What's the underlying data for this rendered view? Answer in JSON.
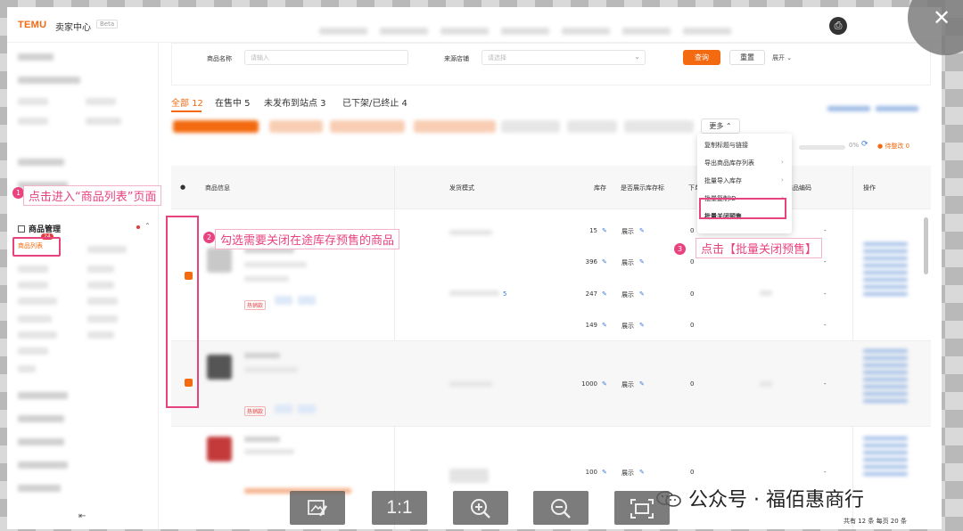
{
  "header": {
    "logo": "TEMU",
    "title": "卖家中心",
    "beta": "Beta"
  },
  "sidebar": {
    "section_title": "商品管理",
    "active_item": "商品列表",
    "active_badge": "24"
  },
  "filters": {
    "product_name_label": "商品名称",
    "product_name_placeholder": "请输入",
    "source_label": "来源店铺",
    "source_placeholder": "请选择",
    "query_button": "查询",
    "reset_button": "重置",
    "expand_button": "展开"
  },
  "tabs": [
    {
      "label": "全部 12",
      "active": true
    },
    {
      "label": "在售中 5",
      "active": false
    },
    {
      "label": "未发布到站点 3",
      "active": false
    },
    {
      "label": "已下架/已终止 4",
      "active": false
    }
  ],
  "toolbar": {
    "more_button": "更多",
    "progress_percent": "0%",
    "warning_badge": "待整改 0"
  },
  "more_menu": {
    "items": [
      {
        "label": "复制标题与链接",
        "has_submenu": false
      },
      {
        "label": "导出商品库存列表",
        "has_submenu": true
      },
      {
        "label": "批量导入库存",
        "has_submenu": true
      },
      {
        "label": "批量复制ID",
        "has_submenu": true
      },
      {
        "label": "批量关闭预售",
        "has_submenu": false
      }
    ]
  },
  "table": {
    "headers": {
      "product_info": "商品信息",
      "shipping_mode": "发货模式",
      "stock": "库存",
      "show_stock": "是否展示库存标",
      "order": "下单",
      "product_code": "商品编码",
      "actions": "操作"
    },
    "rows": [
      {
        "stock": "15",
        "show": "展示",
        "order": "0",
        "code": "-"
      },
      {
        "stock": "396",
        "show": "展示",
        "order": "0",
        "code": "-"
      },
      {
        "stock": "247",
        "show": "展示",
        "order": "0",
        "code": "-"
      },
      {
        "stock": "149",
        "show": "展示",
        "order": "0",
        "code": "-"
      },
      {
        "stock": "1000",
        "show": "展示",
        "order": "0",
        "code": "-"
      },
      {
        "stock": "100",
        "show": "展示",
        "order": "0",
        "code": "-"
      }
    ],
    "tag_hot": "热销款",
    "row_link_count": "5",
    "pagination": "共有 12 条 每页 20 条"
  },
  "annotations": [
    {
      "num": "1",
      "text": "点击进入“商品列表”页面"
    },
    {
      "num": "2",
      "text": "勾选需要关闭在途库存预售的商品"
    },
    {
      "num": "3",
      "text": "点击【批量关闭预售】"
    }
  ],
  "viewer_controls": {
    "actual_size": "1:1"
  },
  "watermark": "公众号 · 福佰惠商行",
  "colors": {
    "brand_orange": "#f36a10",
    "annotation_pink": "#e8427f",
    "link_blue": "#3a7bd5"
  }
}
